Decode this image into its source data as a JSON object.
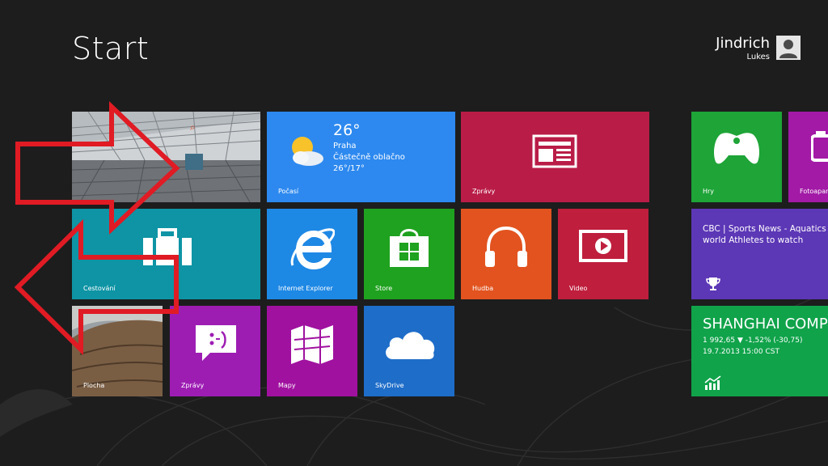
{
  "screen": {
    "title": "Start",
    "background": "#1d1d1d"
  },
  "user": {
    "first_name": "Jindrich",
    "last_name": "Lukes",
    "icon": "user-avatar-icon"
  },
  "tiles": {
    "desktop_photo": {
      "color": "#8a8f94",
      "search_glyph": "⌕"
    },
    "weather": {
      "label": "Počasí",
      "color": "#2d89ef",
      "temperature": "26°",
      "city": "Praha",
      "condition": "Částečně oblačno",
      "range": "26°/17°",
      "icon": "partly-cloudy-icon"
    },
    "news_large": {
      "label": "Zprávy",
      "color": "#b91d47",
      "icon": "newspaper-icon"
    },
    "travel": {
      "label": "Cestování",
      "color": "#0e94a5",
      "icon": "suitcase-icon"
    },
    "ie": {
      "label": "Internet Explorer",
      "color": "#1e88e5",
      "icon": "internet-explorer-icon"
    },
    "store": {
      "label": "Store",
      "color": "#1fa21f",
      "icon": "store-bag-icon"
    },
    "music": {
      "label": "Hudba",
      "color": "#e2531f",
      "icon": "headphones-icon"
    },
    "video": {
      "label": "Video",
      "color": "#bf1e3d",
      "icon": "video-play-icon"
    },
    "desktop": {
      "label": "Plocha",
      "color": "#6a5a4a"
    },
    "messaging": {
      "label": "Zprávy",
      "color": "#9d1db3",
      "icon": "chat-smiley-icon"
    },
    "maps": {
      "label": "Mapy",
      "color": "#a0119f",
      "icon": "map-icon"
    },
    "skydrive": {
      "label": "SkyDrive",
      "color": "#1e6dc9",
      "icon": "cloud-icon"
    },
    "games": {
      "label": "Hry",
      "color": "#1ea437",
      "icon": "xbox-controller-icon"
    },
    "camera": {
      "label": "Fotoaparát",
      "color": "#a21aa6",
      "icon": "camera-icon"
    },
    "sports": {
      "text": "CBC | Sports News - Aquatics world Athletes to watch",
      "color": "#5c37b6",
      "icon": "trophy-icon"
    },
    "finance": {
      "title": "SHANGHAI COMPOSITE",
      "value_line": "1 992,65 ▼ -1,52% (-30,75)",
      "time_line": "19.7.2013 15:00 CST",
      "color": "#10a34a",
      "icon": "stock-chart-icon"
    }
  },
  "annotation": {
    "arrow_color": "#e01b24"
  }
}
